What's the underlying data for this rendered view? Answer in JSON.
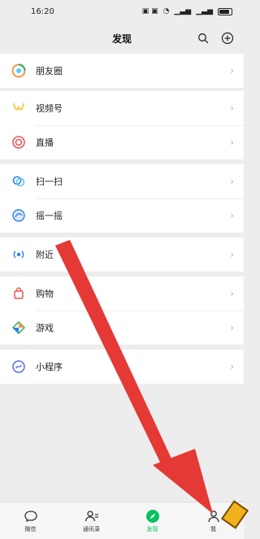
{
  "status": {
    "time": "16:20",
    "icons": [
      "notification-icons",
      "wifi-icon",
      "signal-icon",
      "signal-icon",
      "battery-icon"
    ]
  },
  "header": {
    "title": "发现"
  },
  "groups": [
    {
      "items": [
        {
          "label": "朋友圈",
          "icon": "moments-icon",
          "color": "#f2994a"
        }
      ]
    },
    {
      "items": [
        {
          "label": "视频号",
          "icon": "channels-icon",
          "color": "#f2c94c"
        },
        {
          "label": "直播",
          "icon": "live-icon",
          "color": "#eb5757"
        }
      ]
    },
    {
      "items": [
        {
          "label": "扫一扫",
          "icon": "scan-icon",
          "color": "#2f80ed"
        },
        {
          "label": "摇一摇",
          "icon": "shake-icon",
          "color": "#2f80ed"
        }
      ]
    },
    {
      "items": [
        {
          "label": "附近",
          "icon": "nearby-icon",
          "color": "#2f80ed"
        }
      ]
    },
    {
      "items": [
        {
          "label": "购物",
          "icon": "shopping-icon",
          "color": "#eb5757"
        },
        {
          "label": "游戏",
          "icon": "games-icon",
          "color": "#27ae60"
        }
      ]
    },
    {
      "items": [
        {
          "label": "小程序",
          "icon": "mini-program-icon",
          "color": "#5b6ee1"
        }
      ]
    }
  ],
  "tabs": [
    {
      "label": "微信",
      "icon": "chat-icon",
      "active": false
    },
    {
      "label": "通讯录",
      "icon": "contacts-icon",
      "active": false
    },
    {
      "label": "发现",
      "icon": "discover-icon",
      "active": true
    },
    {
      "label": "我",
      "icon": "me-icon",
      "active": false
    }
  ],
  "accent": "#07c160",
  "annotation_arrow_color": "#e53935"
}
